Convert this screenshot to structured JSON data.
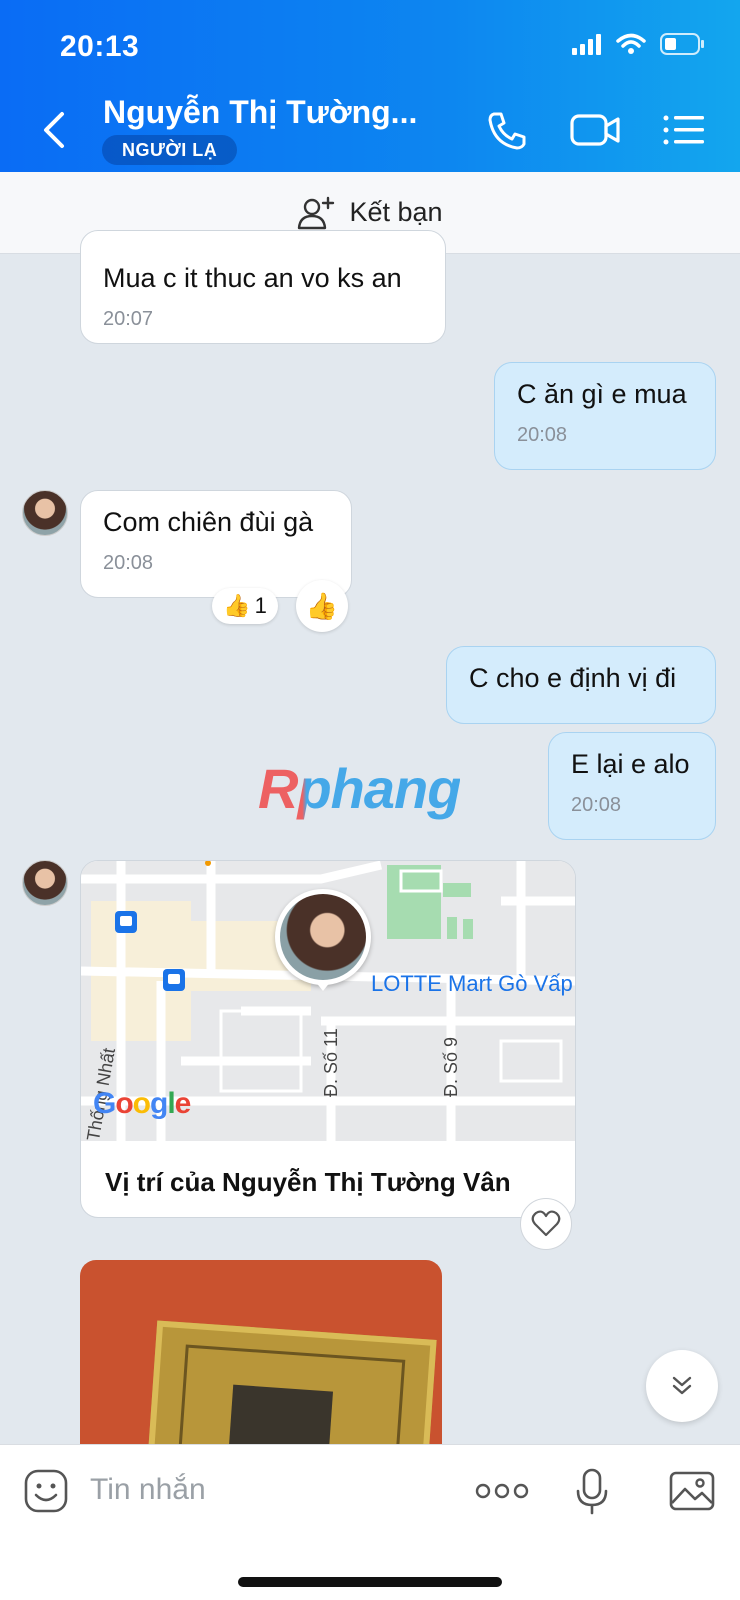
{
  "status_bar": {
    "time": "20:13"
  },
  "header": {
    "title": "Nguyễn Thị Tường...",
    "badge": "NGƯỜI LẠ",
    "colors": {
      "gradient_start": "#0a6cf5",
      "gradient_end": "#13a6ee"
    }
  },
  "add_friend": {
    "label": "Kết bạn"
  },
  "messages": [
    {
      "direction": "in",
      "text": "Mua c it thuc an vo ks an",
      "time": "20:07"
    },
    {
      "direction": "out",
      "text": "C ăn gì e mua",
      "time": "20:08"
    },
    {
      "direction": "in",
      "text": "Com chiên đùi gà",
      "time": "20:08",
      "reaction": {
        "emoji": "👍",
        "count": "1"
      }
    },
    {
      "direction": "out",
      "text": "C cho e định vị đi"
    },
    {
      "direction": "out",
      "text": "E lại e alo",
      "time": "20:08"
    }
  ],
  "watermark": "Rphang",
  "location_card": {
    "poi_label": "LOTTE Mart Gò Vấp",
    "street_1": "Đ. Số 11",
    "street_2": "Đ. Số 9",
    "street_3": "Thống Nhất",
    "map_brand": "Google",
    "caption": "Vị trí của Nguyễn Thị Tường Vân"
  },
  "composer": {
    "placeholder": "Tin nhắn"
  },
  "icons": [
    "back-icon",
    "phone-icon",
    "video-call-icon",
    "menu-list-icon",
    "add-friend-icon",
    "heart-icon",
    "chevron-double-down-icon",
    "sticker-icon",
    "more-icon",
    "microphone-icon",
    "image-icon",
    "signal-icon",
    "wifi-icon",
    "battery-icon",
    "thumbs-up-icon",
    "bus-stop-icon"
  ]
}
